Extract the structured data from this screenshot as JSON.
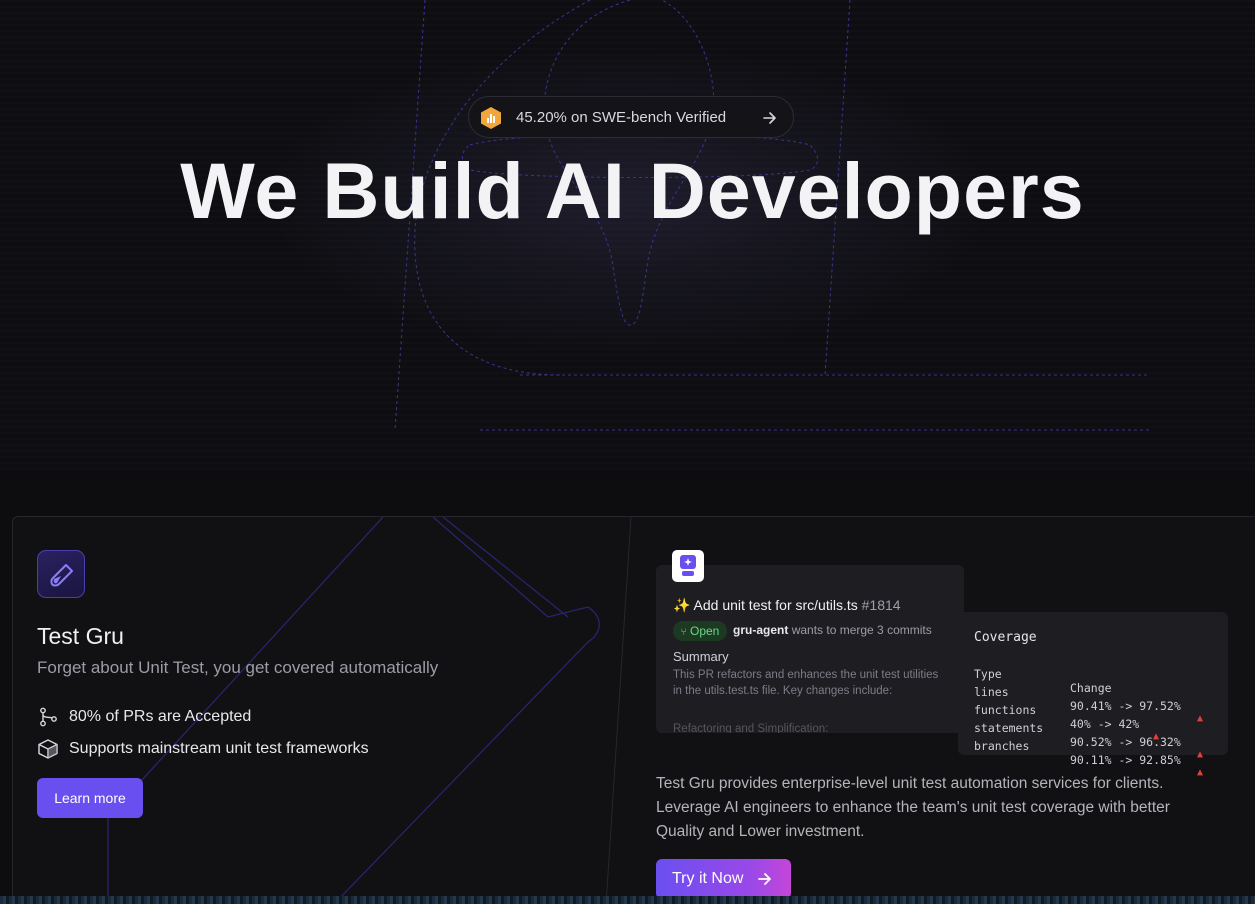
{
  "hero": {
    "badge_text": "45.20% on SWE-bench Verified",
    "title": "We Build AI Developers"
  },
  "product": {
    "name": "Test Gru",
    "tagline": "Forget about Unit Test, you get covered automatically",
    "features": [
      {
        "icon": "git-branch-icon",
        "label": "80% of PRs are Accepted"
      },
      {
        "icon": "package-icon",
        "label": "Supports mainstream unit test frameworks"
      }
    ],
    "learn_more_label": "Learn more",
    "description": "Test Gru provides enterprise-level unit test automation services for clients. Leverage AI engineers to enhance the team's unit test coverage with better Quality and Lower investment.",
    "try_label": "Try it Now"
  },
  "pr": {
    "title": "✨ Add unit test for src/utils.ts",
    "number": "#1814",
    "status": "Open",
    "author": "gru-agent",
    "merge_text": "wants to merge 3 commits",
    "summary_heading": "Summary",
    "summary": "This PR refactors and enhances the unit test utilities in the utils.test.ts file. Key changes include:",
    "faded_line": "Refactoring and Simplification:"
  },
  "coverage": {
    "heading": "Coverage",
    "col_type": "Type",
    "col_change": "Change",
    "rows": [
      {
        "type": "lines",
        "change": "90.41% -> 97.52%"
      },
      {
        "type": "functions",
        "change": "40% -> 42%"
      },
      {
        "type": "statements",
        "change": "90.52% -> 96.32%"
      },
      {
        "type": "branches",
        "change": "90.11% -> 92.85%"
      }
    ],
    "up_color": "#e0403a"
  },
  "colors": {
    "accent": "#6a4ff0",
    "badge_hex": "#f0a63a"
  }
}
